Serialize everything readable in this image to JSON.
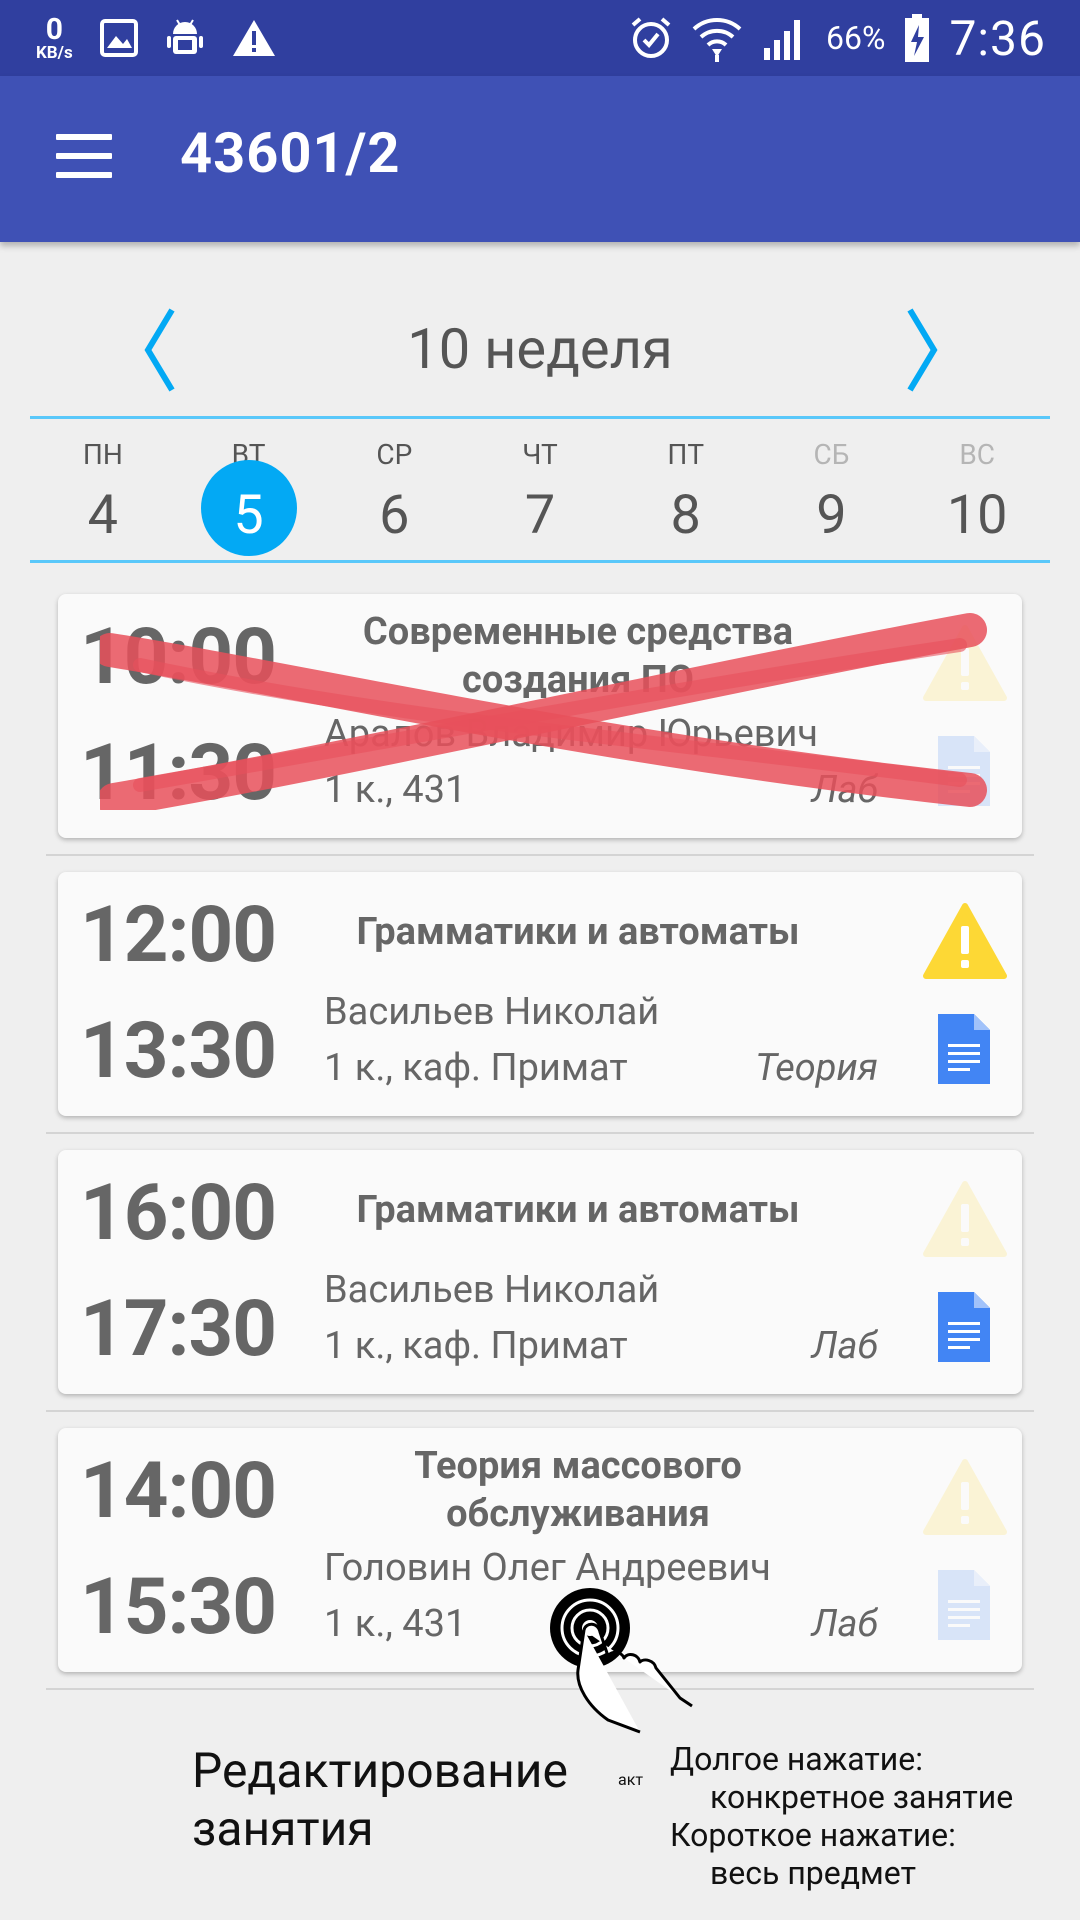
{
  "status_bar": {
    "data_rate": "0",
    "data_unit": "KB/s",
    "icons": [
      "image-icon",
      "android-debug-icon",
      "warning-icon",
      "alarm-icon",
      "wifi-icon",
      "signal-icon",
      "battery-charging-icon"
    ],
    "battery": "66%",
    "time": "7:36"
  },
  "app_bar": {
    "title": "43601/2"
  },
  "week": {
    "label": "10 неделя"
  },
  "days": [
    {
      "name": "ПН",
      "date": "4"
    },
    {
      "name": "ВТ",
      "date": "5"
    },
    {
      "name": "СР",
      "date": "6"
    },
    {
      "name": "ЧТ",
      "date": "7"
    },
    {
      "name": "ПТ",
      "date": "8"
    },
    {
      "name": "СБ",
      "date": "9"
    },
    {
      "name": "ВС",
      "date": "10"
    }
  ],
  "lessons": [
    {
      "start": "10:00",
      "end": "11:30",
      "subject": "Современные средства создания ПО",
      "teacher": "Аралов Владимир Юрьевич",
      "room": "1 к., 431",
      "type": "Лаб",
      "cancelled": true
    },
    {
      "start": "12:00",
      "end": "13:30",
      "subject": "Грамматики и автоматы",
      "teacher": "Васильев Николай",
      "room": "1 к.,  каф. Примат",
      "type": "Теория"
    },
    {
      "start": "16:00",
      "end": "17:30",
      "subject": "Грамматики и автоматы",
      "teacher": "Васильев Николай",
      "room": "1 к.,  каф. Примат",
      "type": "Лаб"
    },
    {
      "start": "14:00",
      "end": "15:30",
      "subject": "Теория массового обслуживания",
      "teacher": "Головин Олег Андреевич",
      "room": "1 к., 431",
      "type": "Лаб"
    }
  ],
  "annotations": {
    "edit_title": "Редактирование занятия",
    "small_label": "акт",
    "long_press_label": "Долгое нажатие:",
    "long_press_text": "конкретное занятие",
    "short_press_label": "Короткое нажатие:",
    "short_press_text": "весь предмет"
  },
  "colors": {
    "status_bar": "#303f9f",
    "app_bar": "#3f51b5",
    "accent": "#03a9f4",
    "warning": "#fdd835",
    "document": "#4285f4",
    "cross": "#e8505b"
  }
}
